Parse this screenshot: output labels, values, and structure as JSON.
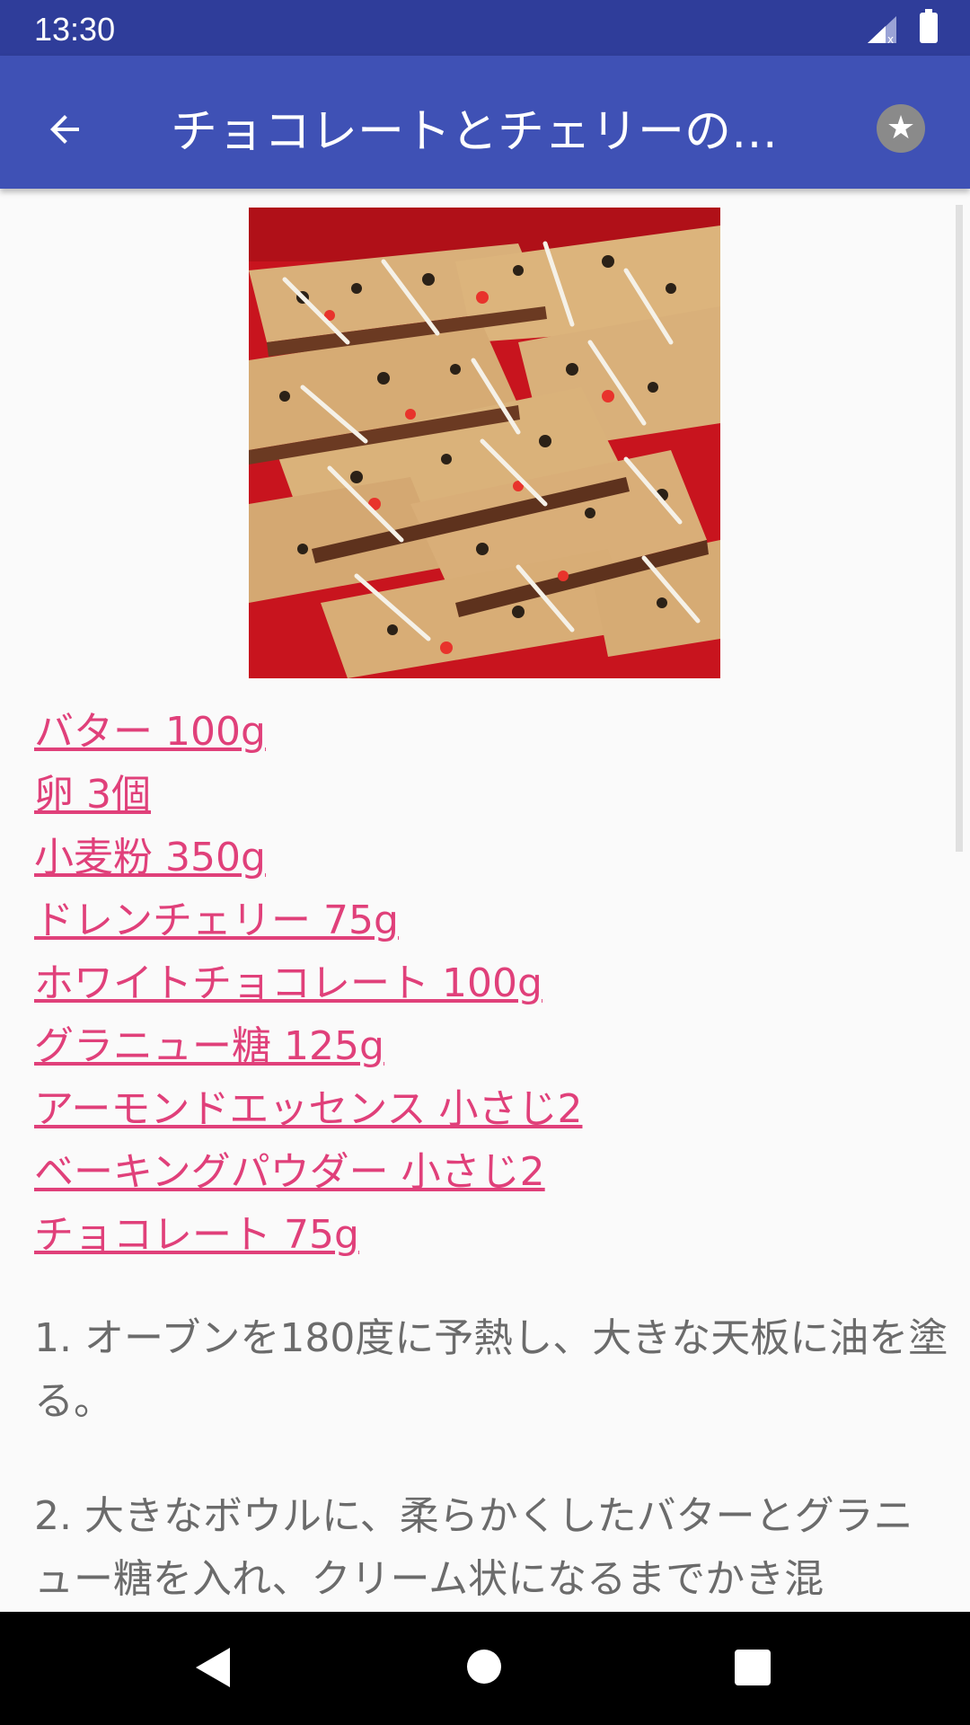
{
  "status_bar": {
    "time": "13:30",
    "icons": [
      "signal-icon",
      "battery-icon"
    ]
  },
  "app_bar": {
    "title": "チョコレートとチェリーの…",
    "back_icon": "arrow-back-icon",
    "favorite_icon": "star-icon",
    "color": "#3f51b5"
  },
  "ingredients": [
    "バター 100g",
    "卵 3個",
    "小麦粉 350g",
    "ドレンチェリー 75g",
    "ホワイトチョコレート 100g",
    "グラニュー糖 125g",
    "アーモンドエッセンス 小さじ2",
    "ベーキングパウダー 小さじ2",
    "チョコレート 75g"
  ],
  "steps": [
    "1. オーブンを180度に予熱し、大きな天板に油を塗る。",
    "2. 大きなボウルに、柔らかくしたバターとグラニュー糖を入れ、クリーム状になるまでかき混"
  ],
  "link_color": "#e0407a",
  "nav_bar": {
    "icons": [
      "nav-back-icon",
      "nav-home-icon",
      "nav-recents-icon"
    ]
  }
}
